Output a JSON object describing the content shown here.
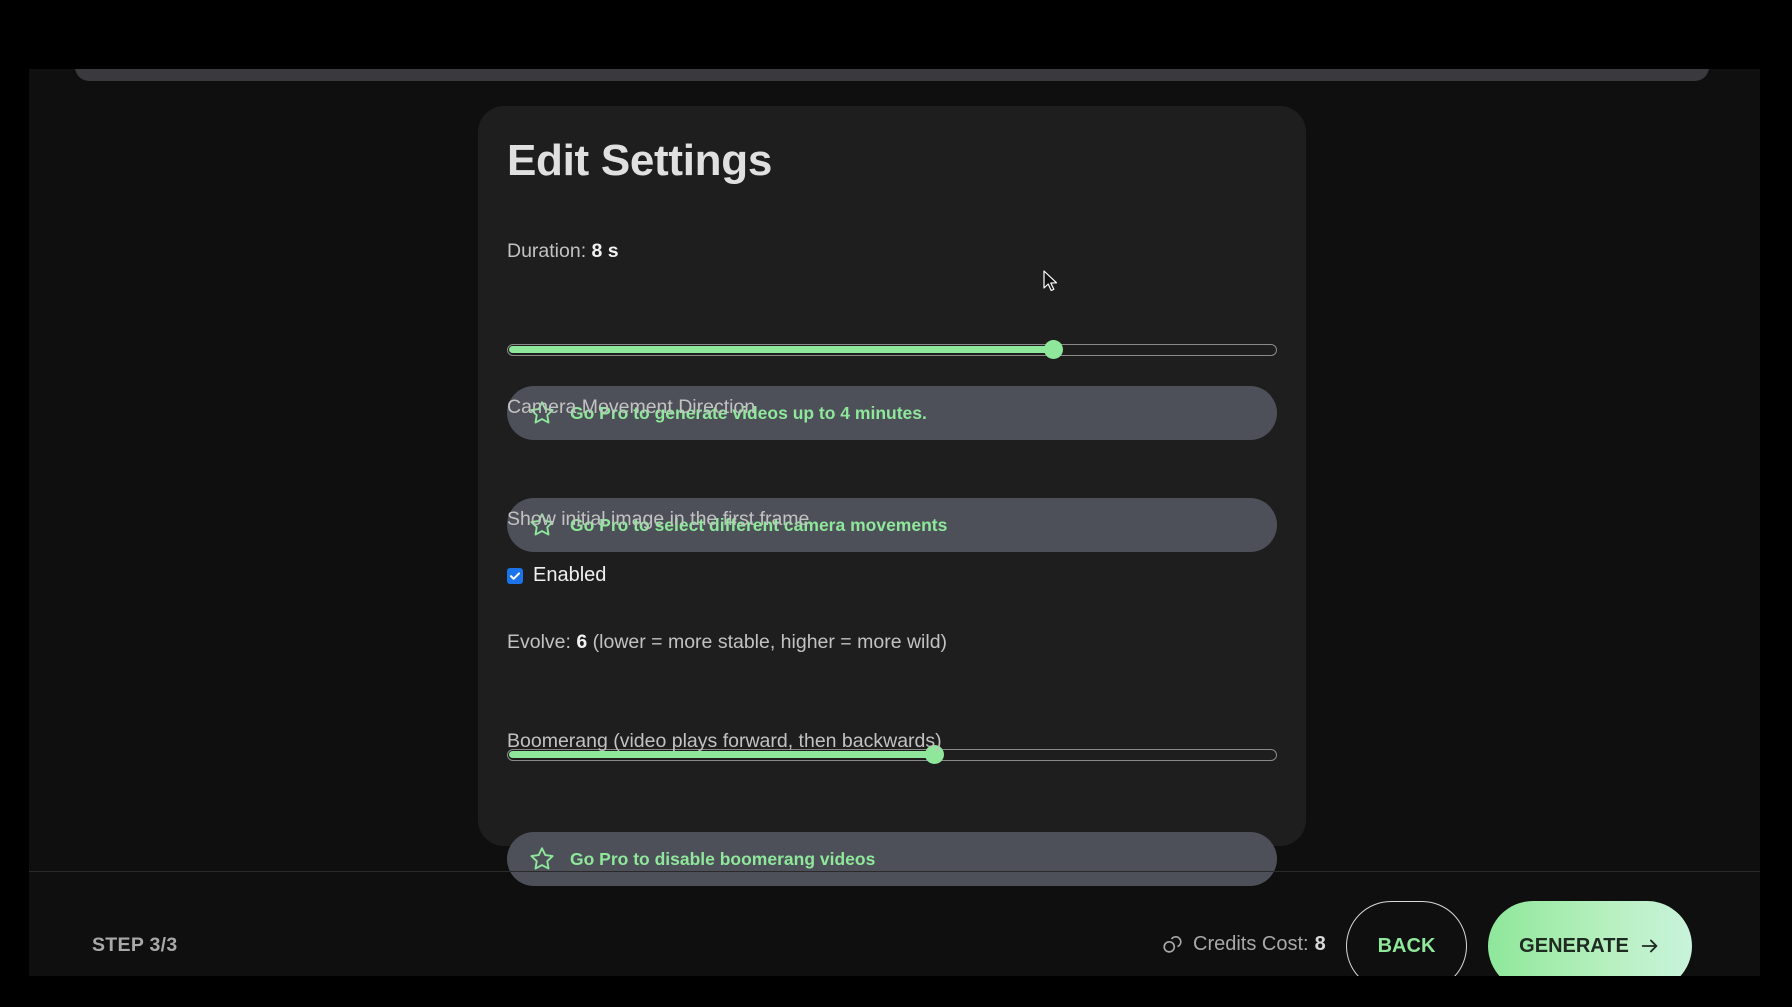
{
  "settings": {
    "title": "Edit Settings",
    "duration": {
      "label": "Duration:",
      "value": "8 s",
      "slider_fraction": 0.71
    },
    "duration_pro_banner": {
      "icon": "star-icon",
      "text": "Go Pro to generate videos up to 4 minutes."
    },
    "camera": {
      "label": "Camera Movement Direction",
      "pro_banner": {
        "icon": "star-icon",
        "text": "Go Pro to select different camera movements"
      }
    },
    "initial_image": {
      "label": "Show initial image in the first frame",
      "checkbox_label": "Enabled",
      "checked": true
    },
    "evolve": {
      "label": "Evolve:",
      "value": "6",
      "hint": "(lower = more stable, higher = more wild)",
      "slider_fraction": 0.555
    },
    "boomerang": {
      "label": "Boomerang (video plays forward, then backwards)",
      "pro_banner": {
        "icon": "star-icon",
        "text": "Go Pro to disable boomerang videos"
      }
    }
  },
  "footer": {
    "step": "STEP 3/3",
    "credits_label": "Credits Cost:",
    "credits_value": "8",
    "credits_icon": "coins-icon",
    "back_label": "BACK",
    "generate_label": "GENERATE",
    "generate_icon": "arrow-right-icon",
    "chat_icon": "chat-icon"
  },
  "colors": {
    "accent": "#8ee79a",
    "card_bg": "#1e1e1e",
    "banner_bg": "#4d5058",
    "checkbox": "#1a73e8"
  }
}
